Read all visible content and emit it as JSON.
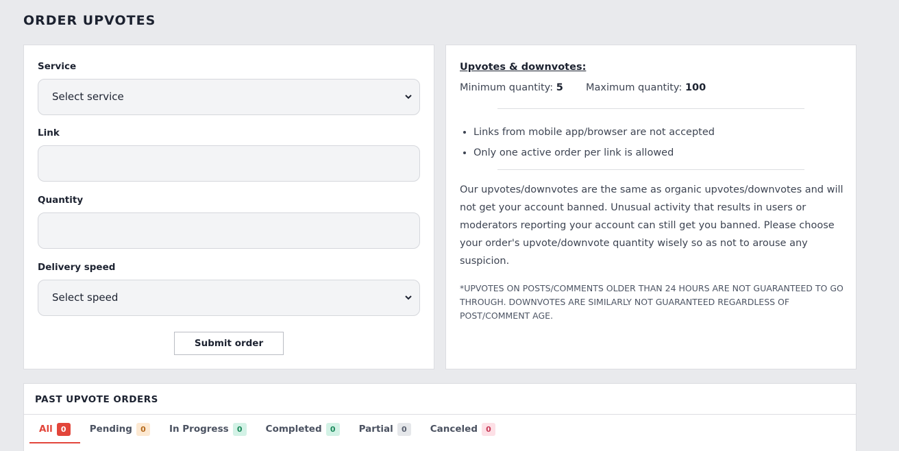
{
  "page": {
    "title": "ORDER UPVOTES"
  },
  "form": {
    "service": {
      "label": "Service",
      "value": "Select service"
    },
    "link": {
      "label": "Link",
      "value": ""
    },
    "quantity": {
      "label": "Quantity",
      "value": ""
    },
    "speed": {
      "label": "Delivery speed",
      "value": "Select speed"
    },
    "submit_label": "Submit order"
  },
  "info": {
    "title": "Upvotes & downvotes:",
    "min_label": "Minimum quantity:",
    "min_value": "5",
    "max_label": "Maximum quantity:",
    "max_value": "100",
    "rules": [
      "Links from mobile app/browser are not accepted",
      "Only one active order per link is allowed"
    ],
    "paragraph": "Our upvotes/downvotes are the same as organic upvotes/downvotes and will not get your account banned. Unusual activity that results in users or moderators reporting your account can still get you banned. Please choose your order's upvote/downvote quantity wisely so as not to arouse any suspicion.",
    "note": "*UPVOTES ON POSTS/COMMENTS OLDER THAN 24 HOURS ARE NOT GUARANTEED TO GO THROUGH. DOWNVOTES ARE SIMILARLY NOT GUARANTEED REGARDLESS OF POST/COMMENT AGE."
  },
  "orders": {
    "title": "PAST UPVOTE ORDERS",
    "tabs": [
      {
        "label": "All",
        "count": "0",
        "badge_bg": "#e2453a",
        "badge_fg": "#ffffff"
      },
      {
        "label": "Pending",
        "count": "0",
        "badge_bg": "#fde9d2",
        "badge_fg": "#b56a1d"
      },
      {
        "label": "In Progress",
        "count": "0",
        "badge_bg": "#d3f2e6",
        "badge_fg": "#1d8a5c"
      },
      {
        "label": "Completed",
        "count": "0",
        "badge_bg": "#d3f2e6",
        "badge_fg": "#1d8a5c"
      },
      {
        "label": "Partial",
        "count": "0",
        "badge_bg": "#e5e7ea",
        "badge_fg": "#5a6170"
      },
      {
        "label": "Canceled",
        "count": "0",
        "badge_bg": "#fde0e6",
        "badge_fg": "#c73a57"
      }
    ]
  }
}
